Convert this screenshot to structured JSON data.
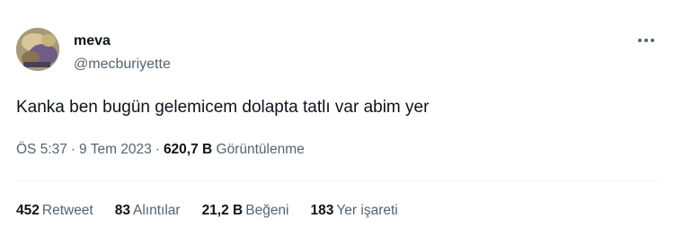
{
  "author": {
    "display_name": "meva",
    "handle": "@mecburiyette",
    "avatar": "avatar-photo"
  },
  "more_icon": "more-horizontal-icon",
  "tweet": {
    "text": "Kanka ben bugün gelemicem dolapta tatlı var abim yer"
  },
  "meta": {
    "time": "ÖS 5:37",
    "separator_1": "·",
    "date": "9 Tem 2023",
    "separator_2": "·",
    "views_count": "620,7 B",
    "views_label": "Görüntülenme"
  },
  "stats": [
    {
      "count": "452",
      "label": "Retweet"
    },
    {
      "count": "83",
      "label": "Alıntılar"
    },
    {
      "count": "21,2 B",
      "label": "Beğeni"
    },
    {
      "count": "183",
      "label": "Yer işareti"
    }
  ],
  "colors": {
    "text_primary": "#0f1419",
    "text_secondary": "#536471",
    "divider": "#eff3f4"
  }
}
